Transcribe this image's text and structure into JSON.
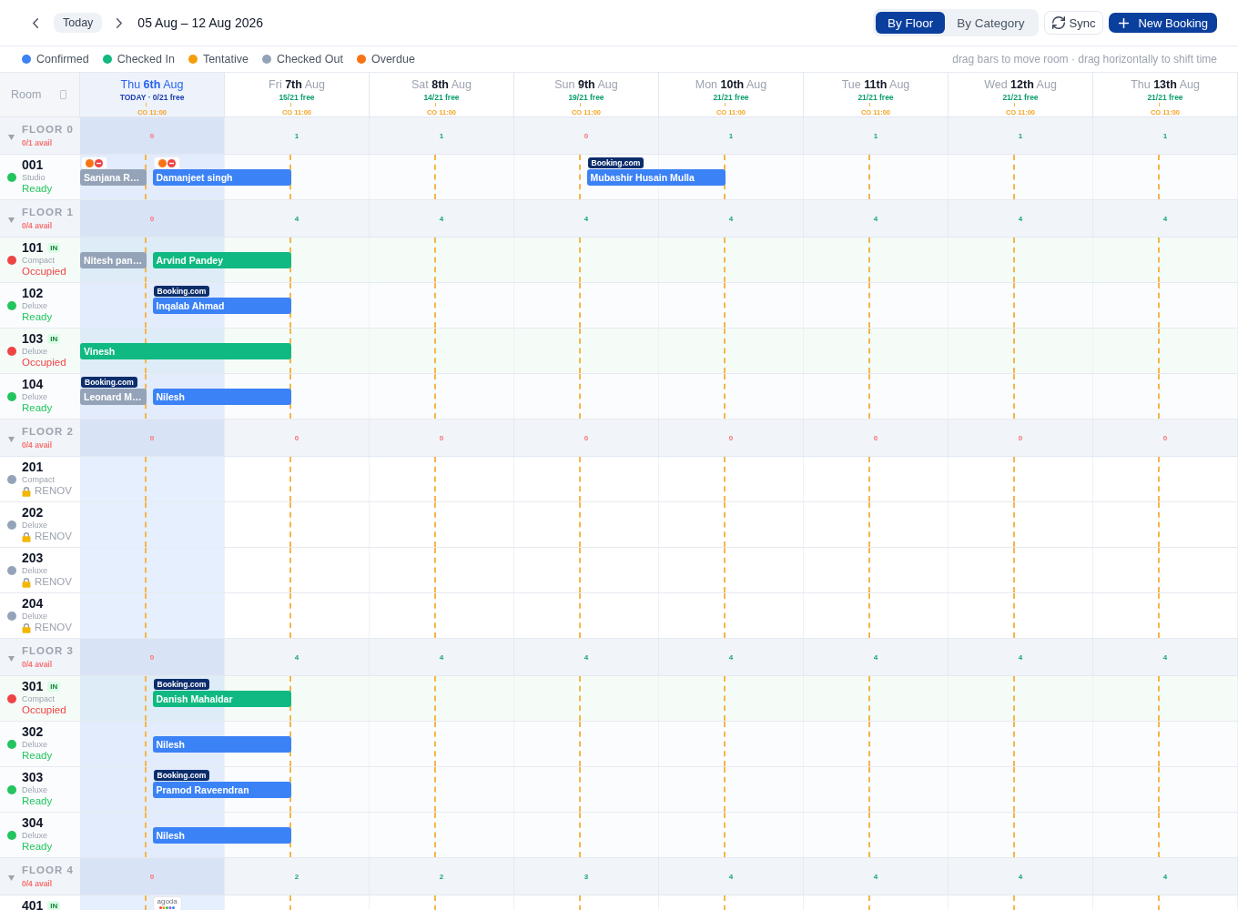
{
  "toolbar": {
    "today_button": "Today",
    "date_range": "05 Aug – 12 Aug 2026",
    "view_modes": [
      {
        "label": "By Floor",
        "selected": true
      },
      {
        "label": "By Category",
        "selected": false
      }
    ],
    "sync_button": "Sync",
    "new_booking_button": "New Booking"
  },
  "legend": {
    "items": [
      {
        "label": "Confirmed",
        "color": "#3b82f6"
      },
      {
        "label": "Checked In",
        "color": "#10b981"
      },
      {
        "label": "Tentative",
        "color": "#f59e0b"
      },
      {
        "label": "Checked Out",
        "color": "#94a3b8"
      },
      {
        "label": "Overdue",
        "color": "#f97316"
      }
    ],
    "hint": "drag bars to move room · drag horizontally to shift time"
  },
  "grid": {
    "room_header": "Room",
    "days": [
      {
        "label": "Thu **6th** Aug",
        "today": true,
        "free": "TODAY · 0/21 free",
        "checkout": "CO 11:00"
      },
      {
        "label": "Fri **7th** Aug",
        "today": false,
        "free": "15/21 free",
        "checkout": "CO 11:00"
      },
      {
        "label": "Sat **8th** Aug",
        "today": false,
        "free": "14/21 free",
        "checkout": "CO 11:00"
      },
      {
        "label": "Sun **9th** Aug",
        "today": false,
        "free": "19/21 free",
        "checkout": "CO 11:00"
      },
      {
        "label": "Mon **10th** Aug",
        "today": false,
        "free": "21/21 free",
        "checkout": "CO 11:00"
      },
      {
        "label": "Tue **11th** Aug",
        "today": false,
        "free": "21/21 free",
        "checkout": "CO 11:00"
      },
      {
        "label": "Wed **12th** Aug",
        "today": false,
        "free": "21/21 free",
        "checkout": "CO 11:00"
      },
      {
        "label": "Thu **13th** Aug",
        "today": false,
        "free": "21/21 free",
        "checkout": "CO 11:00"
      }
    ],
    "floors": [
      {
        "name": "FLOOR 0",
        "expanded": true,
        "avail": "0/1 avail",
        "full": true,
        "counts": [
          {
            "value": "0",
            "sold_out": true
          },
          {
            "value": "1",
            "sold_out": false
          },
          {
            "value": "1",
            "sold_out": false
          },
          {
            "value": "0",
            "sold_out": true
          },
          {
            "value": "1",
            "sold_out": false
          },
          {
            "value": "1",
            "sold_out": false
          },
          {
            "value": "1",
            "sold_out": false
          },
          {
            "value": "1",
            "sold_out": false
          }
        ],
        "rooms": [
          {
            "number": "001",
            "type": "Studio",
            "status": "Ready",
            "kind": "ready",
            "carry_over": {
              "guest": "Sanjana R…",
              "color": "#94a3b8",
              "extends": false,
              "source": {
                "kind": "flags"
              }
            },
            "check_ins": [
              {
                "kind": "booking",
                "guest": "Damanjeet singh",
                "color": "#3b82f6",
                "source": {
                  "kind": "flags"
                }
              },
              {
                "kind": "vacant"
              },
              {
                "kind": "vacant"
              },
              {
                "kind": "booking",
                "guest": "Mubashir Husain Mulla",
                "color": "#3b82f6",
                "source": {
                  "kind": "booking",
                  "label": "Booking.com"
                }
              }
            ]
          }
        ]
      },
      {
        "name": "FLOOR 1",
        "expanded": true,
        "avail": "0/4 avail",
        "full": true,
        "counts": [
          {
            "value": "0",
            "sold_out": true
          },
          {
            "value": "4",
            "sold_out": false
          },
          {
            "value": "4",
            "sold_out": false
          },
          {
            "value": "4",
            "sold_out": false
          },
          {
            "value": "4",
            "sold_out": false
          },
          {
            "value": "4",
            "sold_out": false
          },
          {
            "value": "4",
            "sold_out": false
          },
          {
            "value": "4",
            "sold_out": false
          }
        ],
        "rooms": [
          {
            "number": "101",
            "badge": "IN",
            "type": "Compact",
            "status": "Occupied",
            "kind": "occupied",
            "carry_over": {
              "guest": "Nitesh pan…",
              "color": "#94a3b8",
              "extends": false
            },
            "check_ins": [
              {
                "kind": "booking",
                "guest": "Arvind Pandey",
                "color": "#10b981"
              }
            ]
          },
          {
            "number": "102",
            "type": "Deluxe",
            "status": "Ready",
            "kind": "ready",
            "check_ins": [
              {
                "kind": "booking",
                "guest": "Inqalab Ahmad",
                "color": "#3b82f6",
                "source": {
                  "kind": "booking",
                  "label": "Booking.com"
                }
              }
            ]
          },
          {
            "number": "103",
            "badge": "IN",
            "type": "Deluxe",
            "status": "Occupied",
            "kind": "occupied",
            "carry_over": {
              "guest": "Vinesh",
              "color": "#10b981",
              "extends": true
            }
          },
          {
            "number": "104",
            "type": "Deluxe",
            "status": "Ready",
            "kind": "ready",
            "carry_over": {
              "guest": "Leonard M…",
              "color": "#94a3b8",
              "extends": false,
              "source": {
                "kind": "booking",
                "label": "Booking.com"
              }
            },
            "check_ins": [
              {
                "kind": "booking",
                "guest": "Nilesh",
                "color": "#3b82f6"
              }
            ]
          }
        ]
      },
      {
        "name": "FLOOR 2",
        "expanded": true,
        "avail": "0/4 avail",
        "full": true,
        "counts": [
          {
            "value": "0",
            "sold_out": true
          },
          {
            "value": "0",
            "sold_out": true
          },
          {
            "value": "0",
            "sold_out": true
          },
          {
            "value": "0",
            "sold_out": true
          },
          {
            "value": "0",
            "sold_out": true
          },
          {
            "value": "0",
            "sold_out": true
          },
          {
            "value": "0",
            "sold_out": true
          },
          {
            "value": "0",
            "sold_out": true
          }
        ],
        "rooms": [
          {
            "number": "201",
            "type": "Compact",
            "status": "RENOV",
            "kind": "renovation"
          },
          {
            "number": "202",
            "type": "Deluxe",
            "status": "RENOV",
            "kind": "renovation"
          },
          {
            "number": "203",
            "type": "Deluxe",
            "status": "RENOV",
            "kind": "renovation"
          },
          {
            "number": "204",
            "type": "Deluxe",
            "status": "RENOV",
            "kind": "renovation"
          }
        ]
      },
      {
        "name": "FLOOR 3",
        "expanded": true,
        "avail": "0/4 avail",
        "full": true,
        "counts": [
          {
            "value": "0",
            "sold_out": true
          },
          {
            "value": "4",
            "sold_out": false
          },
          {
            "value": "4",
            "sold_out": false
          },
          {
            "value": "4",
            "sold_out": false
          },
          {
            "value": "4",
            "sold_out": false
          },
          {
            "value": "4",
            "sold_out": false
          },
          {
            "value": "4",
            "sold_out": false
          },
          {
            "value": "4",
            "sold_out": false
          }
        ],
        "rooms": [
          {
            "number": "301",
            "badge": "IN",
            "type": "Compact",
            "status": "Occupied",
            "kind": "occupied",
            "check_ins": [
              {
                "kind": "booking",
                "guest": "Danish Mahaldar",
                "color": "#10b981",
                "source": {
                  "kind": "booking",
                  "label": "Booking.com"
                }
              }
            ]
          },
          {
            "number": "302",
            "type": "Deluxe",
            "status": "Ready",
            "kind": "ready",
            "check_ins": [
              {
                "kind": "booking",
                "guest": "Nilesh",
                "color": "#3b82f6"
              }
            ]
          },
          {
            "number": "303",
            "type": "Deluxe",
            "status": "Ready",
            "kind": "ready",
            "check_ins": [
              {
                "kind": "booking",
                "guest": "Pramod Raveendran",
                "color": "#3b82f6",
                "source": {
                  "kind": "booking",
                  "label": "Booking.com"
                }
              }
            ]
          },
          {
            "number": "304",
            "type": "Deluxe",
            "status": "Ready",
            "kind": "ready",
            "check_ins": [
              {
                "kind": "booking",
                "guest": "Nilesh",
                "color": "#3b82f6"
              }
            ]
          }
        ]
      },
      {
        "name": "FLOOR 4",
        "expanded": true,
        "avail": "0/4 avail",
        "full": true,
        "counts": [
          {
            "value": "0",
            "sold_out": true
          },
          {
            "value": "2",
            "sold_out": false
          },
          {
            "value": "2",
            "sold_out": false
          },
          {
            "value": "3",
            "sold_out": false
          },
          {
            "value": "4",
            "sold_out": false
          },
          {
            "value": "4",
            "sold_out": false
          },
          {
            "value": "4",
            "sold_out": false
          },
          {
            "value": "4",
            "sold_out": false
          }
        ],
        "rooms": [
          {
            "number": "401",
            "badge": "IN",
            "check_ins": [
              {
                "kind": "booking",
                "source": {
                  "kind": "agoda",
                  "label": "agoda"
                }
              }
            ]
          }
        ]
      }
    ]
  }
}
